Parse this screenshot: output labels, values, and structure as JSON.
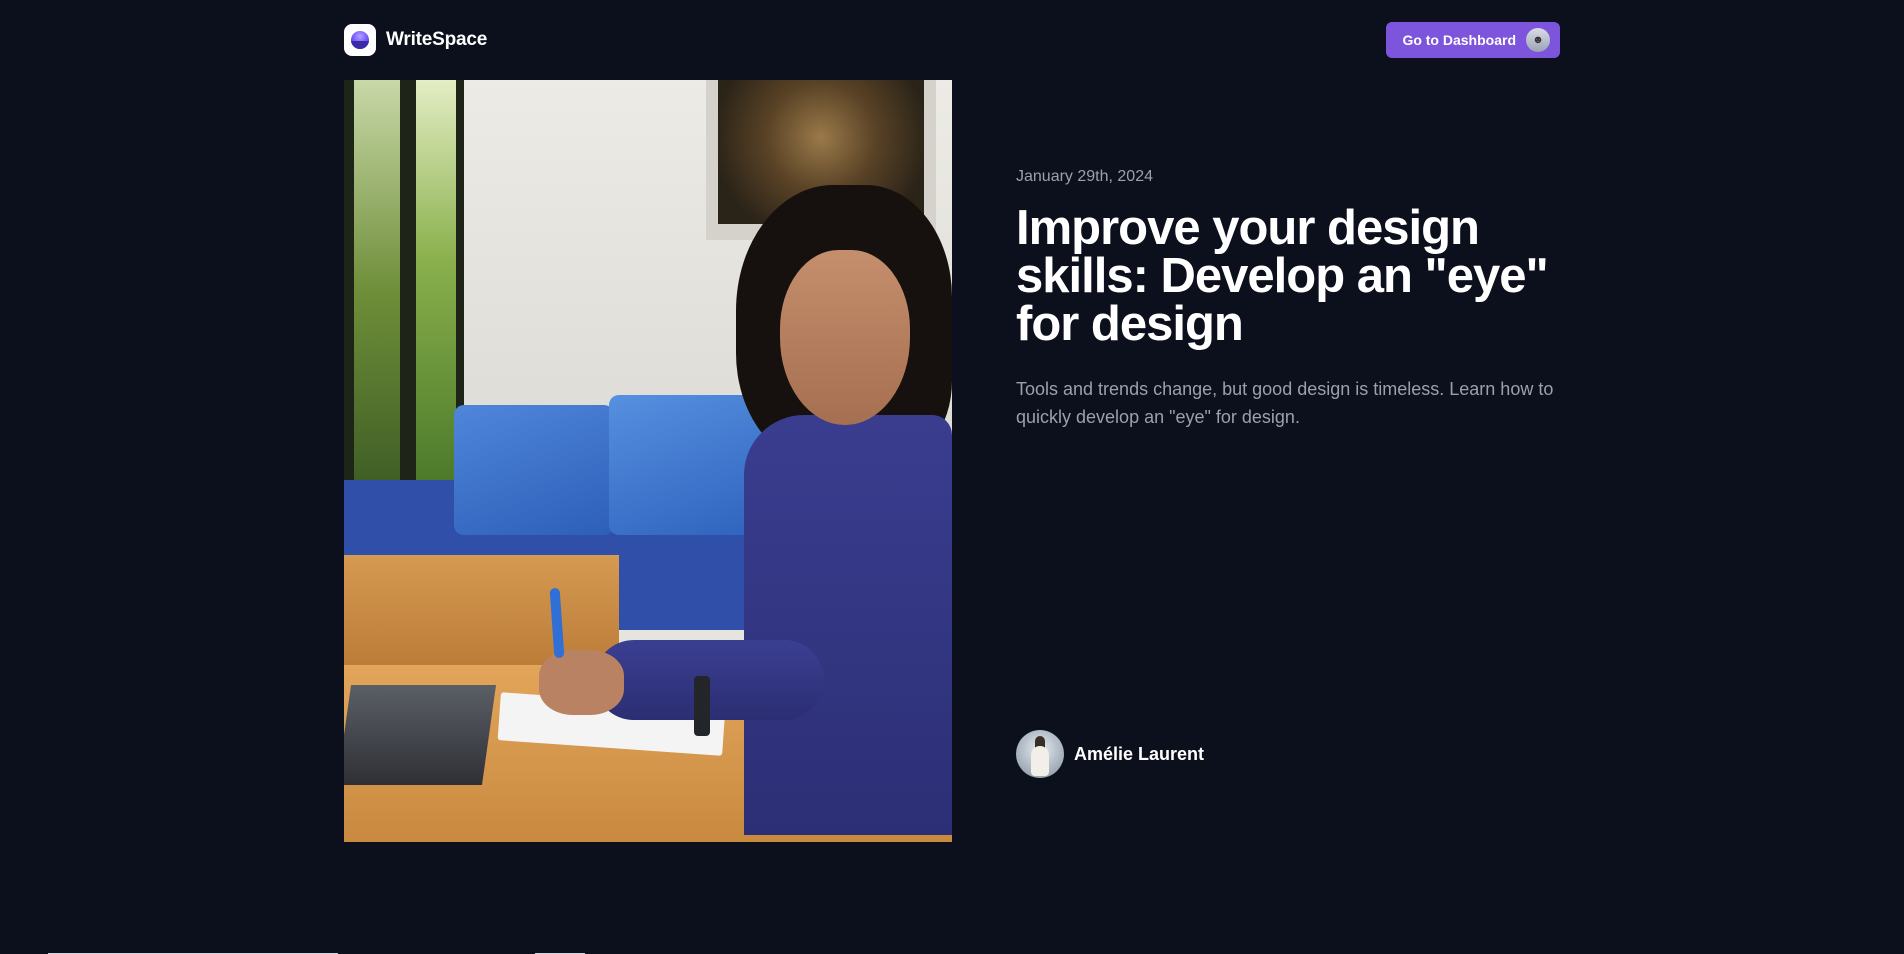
{
  "header": {
    "brand_name": "WriteSpace",
    "brand_icon": "writespace-logo-icon",
    "dashboard_button_label": "Go to Dashboard",
    "dashboard_avatar_icon": "user-avatar-icon"
  },
  "article": {
    "date": "January 29th, 2024",
    "title": "Improve your design skills: Develop an \"eye\" for design",
    "summary": "Tools and trends change, but good design is timeless. Learn how to quickly develop an \"eye\" for design.",
    "author": {
      "name": "Amélie Laurent",
      "avatar_icon": "author-avatar-icon"
    }
  },
  "colors": {
    "background": "#0c0f1c",
    "accent": "#7c55dc",
    "muted_text": "#9aa0ae"
  }
}
